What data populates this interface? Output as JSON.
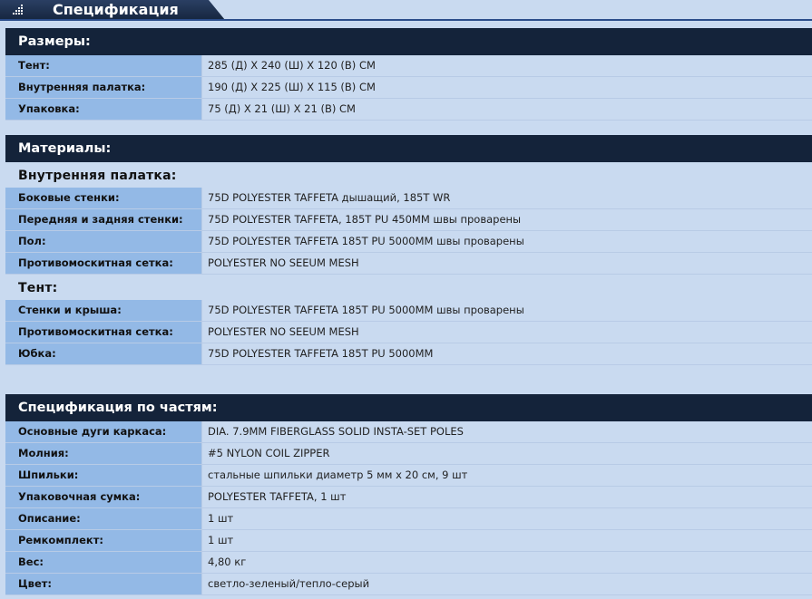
{
  "header": {
    "title": "Спецификация"
  },
  "sections": [
    {
      "title": "Размеры:",
      "rows": [
        {
          "label": "Тент:",
          "value": "285 (Д) X 240 (Ш) X 120 (В) СМ"
        },
        {
          "label": "Внутренняя палатка:",
          "value": "190 (Д) X 225 (Ш) X 115 (В) СМ"
        },
        {
          "label": "Упаковка:",
          "value": "75 (Д) X 21 (Ш) X 21 (В) СМ"
        }
      ]
    },
    {
      "title": "Материалы:",
      "groups": [
        {
          "subtitle": "Внутренняя палатка:",
          "rows": [
            {
              "label": "Боковые стенки:",
              "value": "75D POLYESTER TAFFETA дышащий, 185T WR"
            },
            {
              "label": "Передняя и задняя стенки:",
              "value": "75D POLYESTER TAFFETA, 185T PU 450MM швы проварены"
            },
            {
              "label": "Пол:",
              "value": "75D POLYESTER TAFFETA 185T PU 5000MM швы проварены"
            },
            {
              "label": "Противомоскитная сетка:",
              "value": "POLYESTER NO SEEUM MESH"
            }
          ]
        },
        {
          "subtitle": "Тент:",
          "rows": [
            {
              "label": "Стенки и крыша:",
              "value": "75D POLYESTER TAFFETA 185T PU 5000MM швы проварены"
            },
            {
              "label": "Противомоскитная сетка:",
              "value": "POLYESTER NO SEEUM MESH"
            },
            {
              "label": "Юбка:",
              "value": "75D POLYESTER TAFFETA 185T PU 5000MM"
            }
          ]
        }
      ]
    },
    {
      "title": "Спецификация по частям:",
      "rows": [
        {
          "label": "Основные дуги каркаса:",
          "value": "DIA. 7.9MM FIBERGLASS SOLID INSTA-SET POLES"
        },
        {
          "label": "Молния:",
          "value": "#5 NYLON COIL ZIPPER"
        },
        {
          "label": "Шпильки:",
          "value": "стальные шпильки диаметр 5 мм х 20 см, 9 шт"
        },
        {
          "label": "Упаковочная сумка:",
          "value": "POLYESTER TAFFETA, 1 шт"
        },
        {
          "label": "Описание:",
          "value": "1 шт"
        },
        {
          "label": "Ремкомплект:",
          "value": "1 шт"
        },
        {
          "label": "Вес:",
          "value": "4,80 кг"
        },
        {
          "label": "Цвет:",
          "value": "светло-зеленый/тепло-серый"
        }
      ]
    }
  ],
  "colors": {
    "section_header": "#14233a",
    "label_cell": "#93b9e6",
    "value_cell": "#c9daf0"
  }
}
